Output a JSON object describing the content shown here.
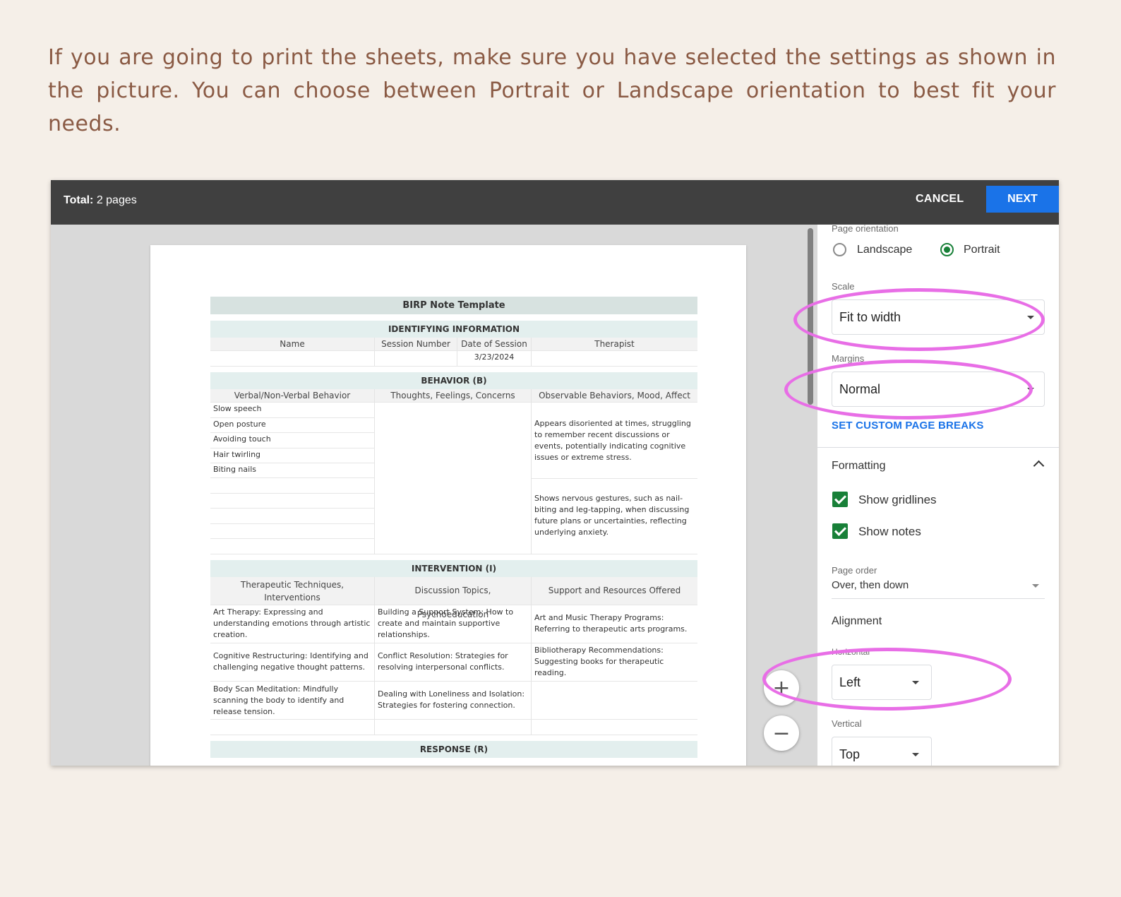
{
  "intro_text": "If you are going to print the sheets, make sure you have selected the settings as shown in the picture. You can choose between Portrait or Landscape orientation to best fit your needs.",
  "toolbar": {
    "total_label": "Total:",
    "total_value": "2 pages",
    "cancel_label": "CANCEL",
    "next_label": "NEXT"
  },
  "sheet": {
    "title": "BIRP Note Template",
    "identifying": {
      "heading": "IDENTIFYING INFORMATION",
      "headers": [
        "Name",
        "Session Number",
        "Date of Session",
        "Therapist"
      ],
      "values": [
        "",
        "",
        "3/23/2024",
        ""
      ]
    },
    "behavior": {
      "heading": "BEHAVIOR (B)",
      "headers": [
        "Verbal/Non-Verbal Behavior",
        "Thoughts, Feelings, Concerns",
        "Observable Behaviors, Mood, Affect"
      ],
      "verbal_items": [
        "Slow speech",
        "Open posture",
        "Avoiding touch",
        "Hair twirling",
        "Biting nails"
      ],
      "observations": [
        "Appears disoriented at times, struggling to remember recent discussions or events, potentially indicating cognitive issues or extreme stress.",
        "Shows nervous gestures, such as nail-biting and leg-tapping, when discussing future plans or uncertainties, reflecting underlying anxiety."
      ]
    },
    "intervention": {
      "heading": "INTERVENTION (I)",
      "headers": [
        "Therapeutic Techniques, Interventions",
        "Discussion Topics, Psychoeducation",
        "Support and Resources Offered"
      ],
      "rows": [
        [
          "Art Therapy: Expressing and understanding emotions through artistic creation.",
          "Building a Support System: How to create and maintain supportive relationships.",
          "Art and Music Therapy Programs: Referring to therapeutic arts programs."
        ],
        [
          "Cognitive Restructuring: Identifying and challenging negative thought patterns.",
          "Conflict Resolution: Strategies for resolving interpersonal conflicts.",
          "Bibliotherapy Recommendations: Suggesting books for therapeutic reading."
        ],
        [
          "Body Scan Meditation: Mindfully scanning the body to identify and release tension.",
          "Dealing with Loneliness and Isolation: Strategies for fostering connection.",
          ""
        ]
      ]
    },
    "response_heading": "RESPONSE (R)"
  },
  "settings": {
    "orientation_label": "Page orientation",
    "landscape": "Landscape",
    "portrait": "Portrait",
    "scale_label": "Scale",
    "scale_value": "Fit to width",
    "margins_label": "Margins",
    "margins_value": "Normal",
    "custom_breaks": "SET CUSTOM PAGE BREAKS",
    "formatting": "Formatting",
    "show_gridlines": "Show gridlines",
    "show_notes": "Show notes",
    "page_order_label": "Page order",
    "page_order_value": "Over, then down",
    "alignment": "Alignment",
    "horizontal_label": "Horizontal",
    "horizontal_value": "Left",
    "vertical_label": "Vertical",
    "vertical_value": "Top"
  },
  "zoom": {
    "in": "+",
    "out": "−"
  },
  "colors": {
    "accent": "#1a73e8",
    "check": "#188038",
    "highlight": "#e86ee6",
    "intro": "#8a5a44"
  }
}
